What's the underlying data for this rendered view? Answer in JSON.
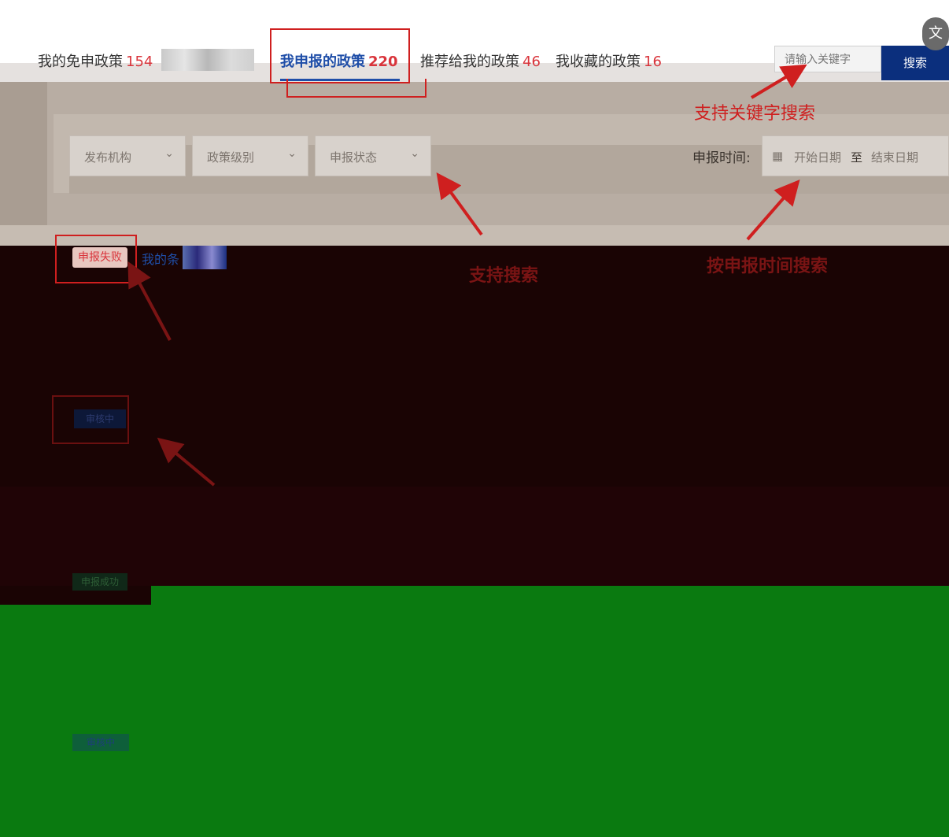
{
  "tabs": [
    {
      "label": "我的免申政策",
      "count": "154"
    },
    {
      "label": "我申报的政策",
      "count": "220"
    },
    {
      "label": "推荐给我的政策",
      "count": "46"
    },
    {
      "label": "我收藏的政策",
      "count": "16"
    }
  ],
  "search": {
    "placeholder": "请输入关键字",
    "button_label": "搜索"
  },
  "translate_icon": "translate-icon",
  "filters": {
    "dropdowns": [
      {
        "label": "发布机构"
      },
      {
        "label": "政策级别"
      },
      {
        "label": "申报状态"
      }
    ],
    "date_label": "申报时间:",
    "date_start_placeholder": "开始日期",
    "date_separator": "至",
    "date_end_placeholder": "结束日期"
  },
  "list": {
    "first_status": "申报失败",
    "first_title": "我的条",
    "second_status": "审核中",
    "third_status": "申报成功",
    "fourth_status": "审核中"
  },
  "annotations": {
    "keyword_search": "支持关键字搜索",
    "filter_search": "支持搜索",
    "date_search": "按申报时间搜索"
  },
  "colors": {
    "accent_blue": "#1f4ea8",
    "count_red": "#d9343b",
    "annotation_red": "#cf1f1f",
    "search_button": "#0b2f7d"
  }
}
